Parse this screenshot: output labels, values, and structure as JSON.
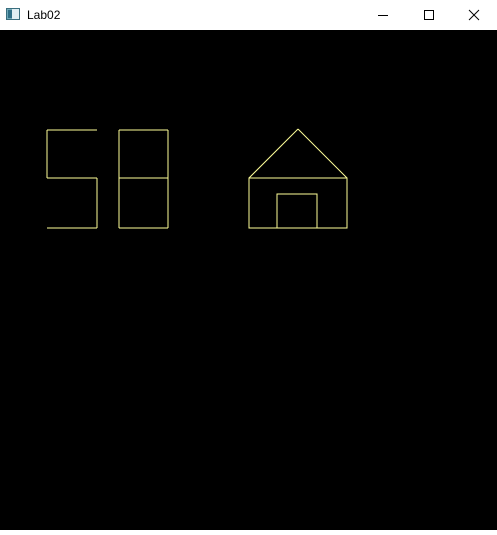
{
  "window": {
    "title": "Lab02",
    "icon": "app-window-icon",
    "buttons": {
      "minimize_icon": "minimize-icon",
      "maximize_icon": "maximize-icon",
      "close_icon": "close-icon"
    }
  },
  "canvas": {
    "background": "#000000",
    "stroke_color": "#ffff99",
    "shapes": [
      "digit-5",
      "digit-8",
      "house"
    ]
  }
}
